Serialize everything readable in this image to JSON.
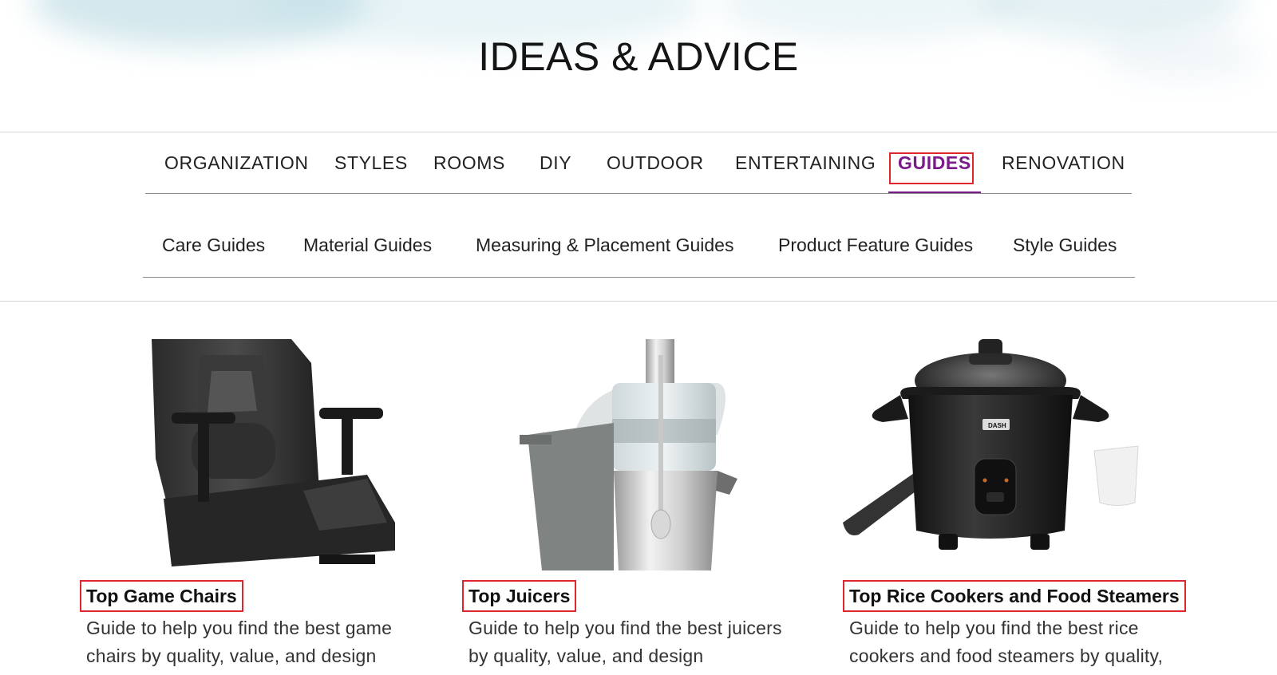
{
  "header": {
    "title": "IDEAS & ADVICE"
  },
  "primary_nav": {
    "items": [
      {
        "label": "ORGANIZATION"
      },
      {
        "label": "STYLES"
      },
      {
        "label": "ROOMS"
      },
      {
        "label": "DIY"
      },
      {
        "label": "OUTDOOR"
      },
      {
        "label": "ENTERTAINING"
      },
      {
        "label": "GUIDES",
        "active": true
      },
      {
        "label": "RENOVATION"
      }
    ],
    "active_color": "#7b1a8a"
  },
  "secondary_nav": {
    "items": [
      {
        "label": "Care Guides"
      },
      {
        "label": "Material Guides"
      },
      {
        "label": "Measuring & Placement Guides"
      },
      {
        "label": "Product Feature Guides"
      },
      {
        "label": "Style Guides"
      }
    ]
  },
  "cards": [
    {
      "title": "Top Game Chairs",
      "description": "Guide to help you find the best game chairs by quality, value, and design",
      "image_icon": "gaming-chair-icon"
    },
    {
      "title": "Top Juicers",
      "description": "Guide to help you find the best juicers by quality, value, and design",
      "image_icon": "juicer-icon"
    },
    {
      "title": "Top Rice Cookers and Food Steamers",
      "description": "Guide to help you find the best rice cookers and food steamers by quality,",
      "image_icon": "rice-cooker-icon",
      "brand_label": "DASH"
    }
  ],
  "colors": {
    "highlight_border": "#e0262c",
    "accent": "#7b1a8a"
  }
}
